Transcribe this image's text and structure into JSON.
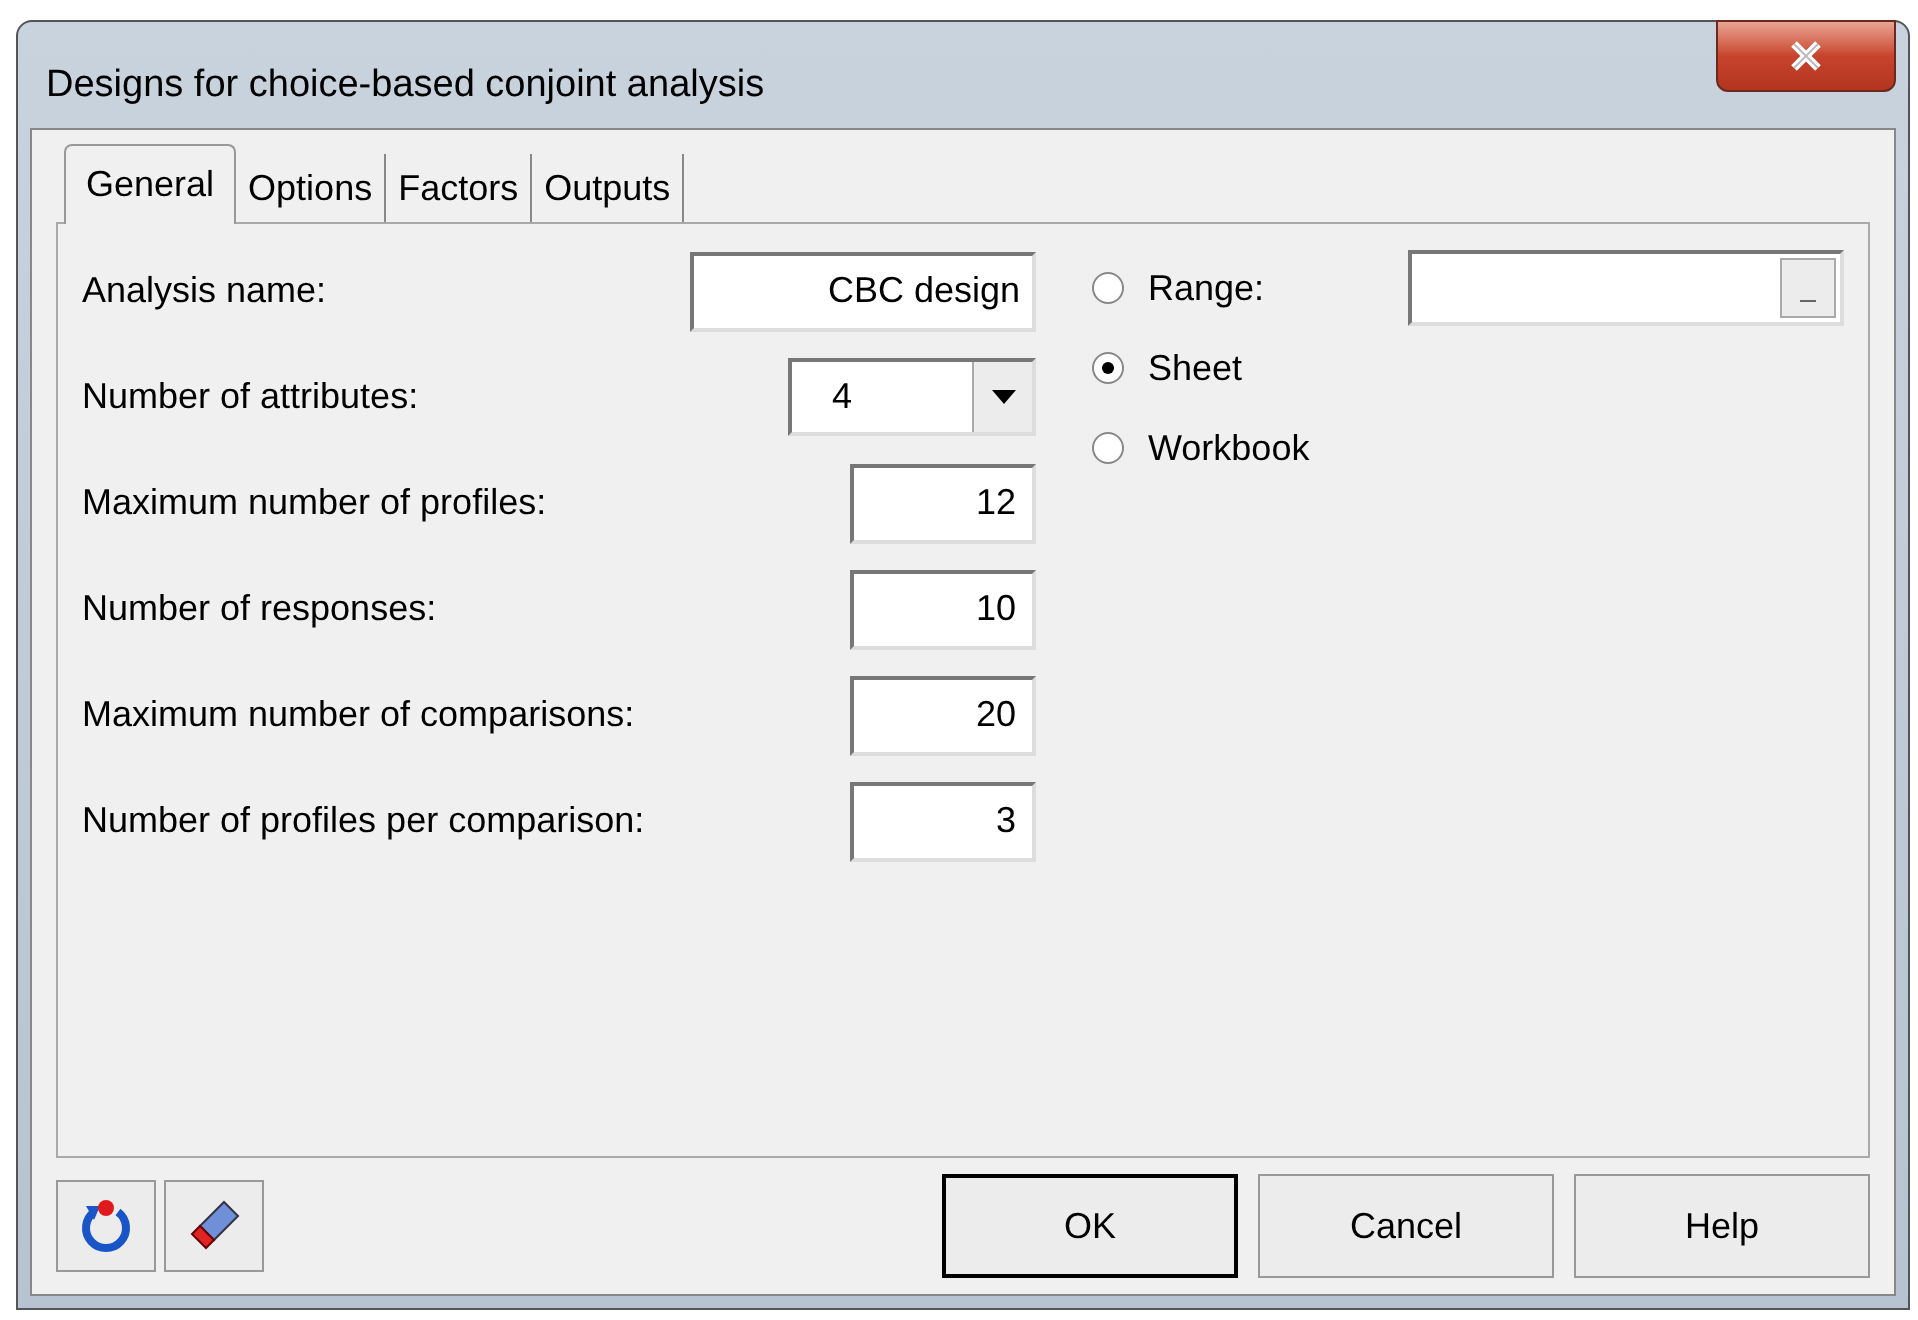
{
  "window": {
    "title": "Designs for choice-based conjoint analysis"
  },
  "tabs": [
    {
      "label": "General",
      "selected": true
    },
    {
      "label": "Options",
      "selected": false
    },
    {
      "label": "Factors",
      "selected": false
    },
    {
      "label": "Outputs",
      "selected": false
    }
  ],
  "fields": [
    {
      "kind": "text",
      "label": "Analysis name:",
      "value": "CBC design"
    },
    {
      "kind": "dropdown",
      "label": "Number of attributes:",
      "value": "4"
    },
    {
      "kind": "number",
      "label": "Maximum number of profiles:",
      "value": "12"
    },
    {
      "kind": "number",
      "label": "Number of responses:",
      "value": "10"
    },
    {
      "kind": "number",
      "label": "Maximum number of comparisons:",
      "value": "20"
    },
    {
      "kind": "number",
      "label": "Number of profiles per comparison:",
      "value": "3"
    }
  ],
  "output_target": [
    {
      "label": "Range:",
      "selected": false
    },
    {
      "label": "Sheet",
      "selected": true
    },
    {
      "label": "Workbook",
      "selected": false
    }
  ],
  "buttons": [
    {
      "label": "OK",
      "default": true
    },
    {
      "label": "Cancel",
      "default": false
    },
    {
      "label": "Help",
      "default": false
    }
  ]
}
